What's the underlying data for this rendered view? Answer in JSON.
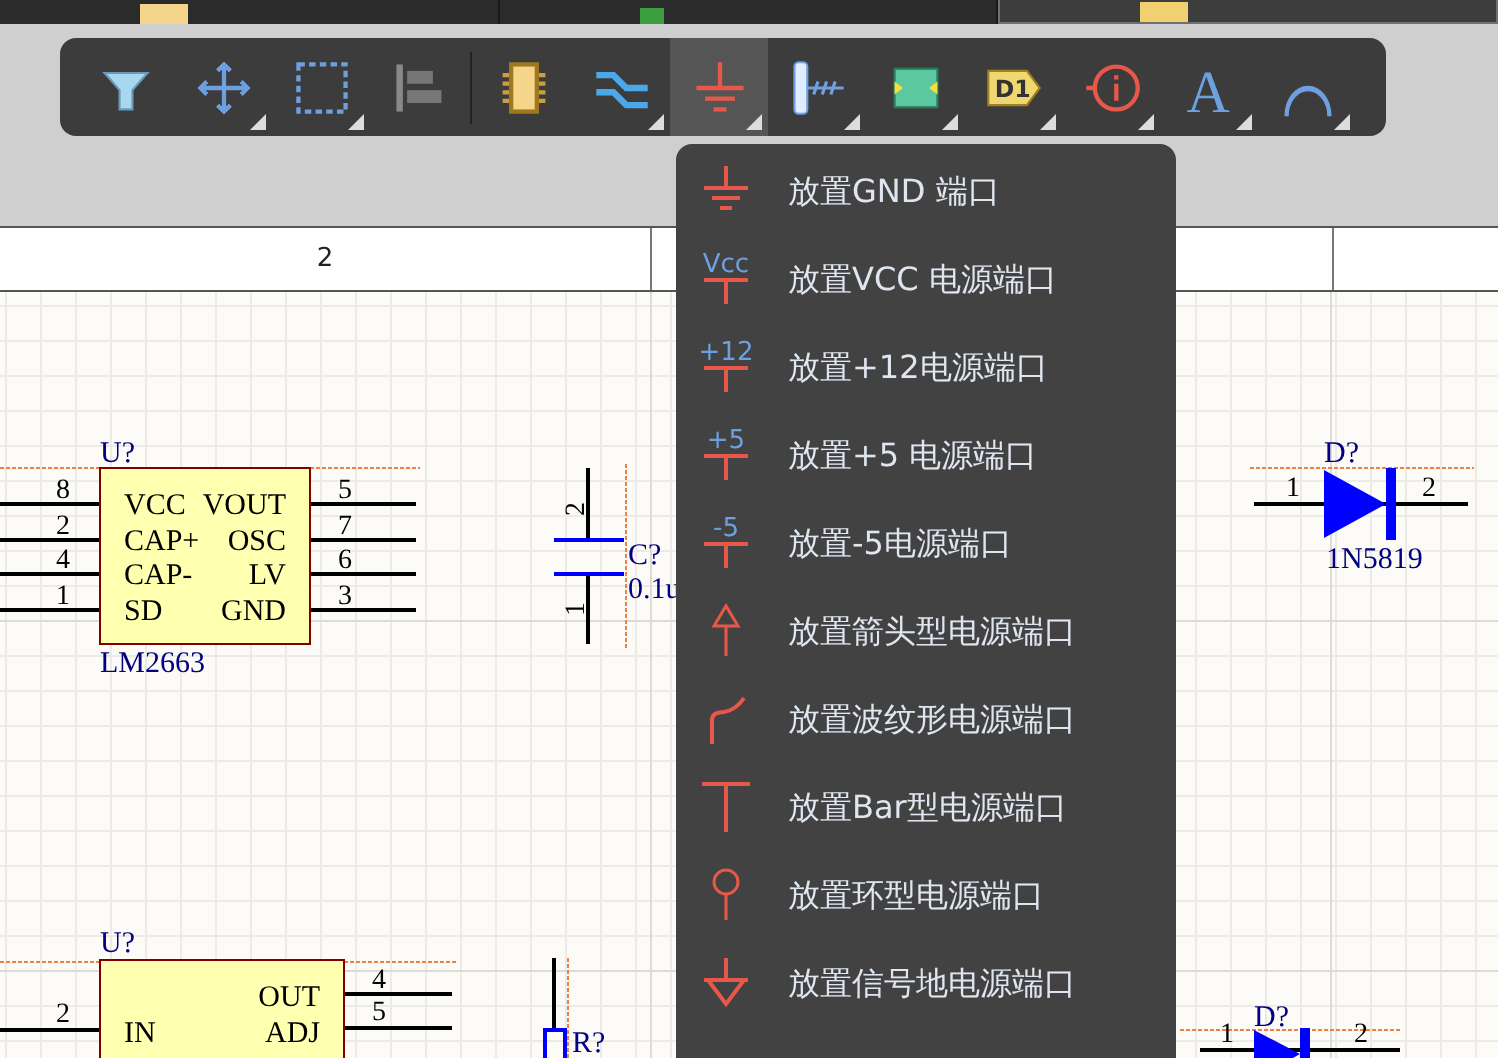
{
  "tabs": [
    {
      "kind": "ic",
      "selected": false
    },
    {
      "kind": "chip",
      "selected": false
    },
    {
      "kind": "folder",
      "selected": true
    }
  ],
  "toolbar": {
    "buttons": [
      {
        "kind": "filter",
        "selected": false,
        "dropdown": false
      },
      {
        "kind": "move",
        "selected": false,
        "dropdown": true
      },
      {
        "kind": "select",
        "selected": false,
        "dropdown": true
      },
      {
        "kind": "align",
        "selected": false,
        "dropdown": false
      },
      {
        "kind": "part",
        "selected": false,
        "dropdown": false
      },
      {
        "kind": "bus",
        "selected": false,
        "dropdown": true
      },
      {
        "kind": "ground",
        "selected": true,
        "dropdown": true
      },
      {
        "kind": "harness",
        "selected": false,
        "dropdown": true
      },
      {
        "kind": "sheet",
        "selected": false,
        "dropdown": true
      },
      {
        "kind": "port",
        "selected": false,
        "dropdown": true,
        "text": "D1"
      },
      {
        "kind": "info",
        "selected": false,
        "dropdown": true
      },
      {
        "kind": "text",
        "selected": false,
        "dropdown": true,
        "text": "A"
      },
      {
        "kind": "arc",
        "selected": false,
        "dropdown": true
      }
    ]
  },
  "ruler": {
    "labels": [
      "2"
    ]
  },
  "menu": {
    "items": [
      {
        "kind": "ground",
        "label": "放置GND 端口"
      },
      {
        "kind": "labeled",
        "icon_text": "Vcc",
        "label": "放置VCC 电源端口"
      },
      {
        "kind": "labeled",
        "icon_text": "+12",
        "label": "放置+12电源端口"
      },
      {
        "kind": "labeled",
        "icon_text": "+5",
        "label": "放置+5 电源端口"
      },
      {
        "kind": "labeled",
        "icon_text": "-5",
        "label": "放置-5电源端口"
      },
      {
        "kind": "arrow",
        "label": "放置箭头型电源端口"
      },
      {
        "kind": "wave",
        "label": "放置波纹形电源端口"
      },
      {
        "kind": "bar",
        "label": "放置Bar型电源端口"
      },
      {
        "kind": "circle",
        "label": "放置环型电源端口"
      },
      {
        "kind": "signal-ground",
        "label": "放置信号地电源端口"
      }
    ]
  },
  "schematic": {
    "parts": [
      {
        "kind": "ic8",
        "designator": "U?",
        "comment": "LM2663",
        "left_pins": [
          {
            "number": "8",
            "name": "VCC"
          },
          {
            "number": "2",
            "name": "CAP+"
          },
          {
            "number": "4",
            "name": "CAP-"
          },
          {
            "number": "1",
            "name": "SD"
          }
        ],
        "right_pins": [
          {
            "number": "5",
            "name": "VOUT"
          },
          {
            "number": "7",
            "name": "OSC"
          },
          {
            "number": "6",
            "name": "LV"
          },
          {
            "number": "3",
            "name": "GND"
          }
        ]
      },
      {
        "kind": "capacitor",
        "designator": "C?",
        "comment": "0.1u",
        "pin_numbers": [
          "2",
          "1"
        ]
      },
      {
        "kind": "diode",
        "designator": "D?",
        "comment": "1N5819",
        "pin_numbers": [
          "1",
          "2"
        ]
      },
      {
        "kind": "ic-reg",
        "designator": "U?",
        "left_pins": [
          {
            "number": "2",
            "name": "IN"
          }
        ],
        "right_pins": [
          {
            "number": "4",
            "name": "OUT"
          },
          {
            "number": "5",
            "name": "ADJ"
          }
        ]
      },
      {
        "kind": "resistor",
        "designator": "R?"
      },
      {
        "kind": "diode-bottom",
        "designator": "D?",
        "pin_numbers": [
          "1",
          "2"
        ]
      }
    ]
  }
}
